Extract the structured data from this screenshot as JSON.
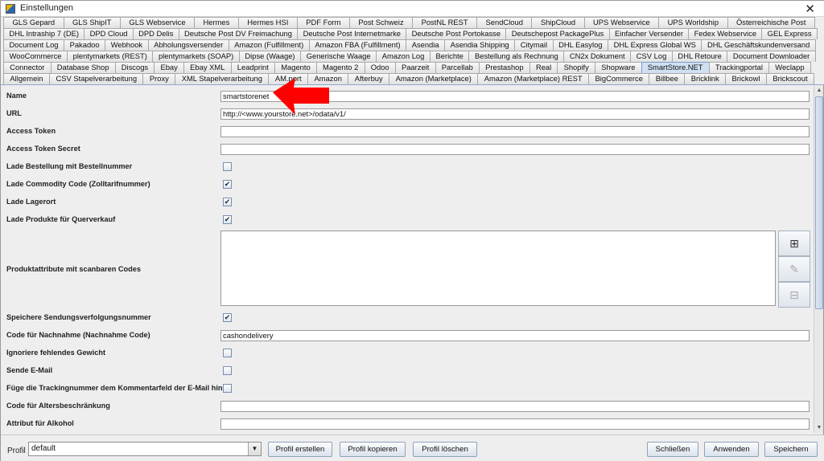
{
  "window": {
    "title": "Einstellungen",
    "close": "✕"
  },
  "tabs": {
    "rows": [
      [
        "GLS Gepard",
        "GLS ShipIT",
        "GLS Webservice",
        "Hermes",
        "Hermes HSI",
        "PDF Form",
        "Post Schweiz",
        "PostNL REST",
        "SendCloud",
        "ShipCloud",
        "UPS Webservice",
        "UPS Worldship",
        "Österreichische Post"
      ],
      [
        "DHL Intraship 7 (DE)",
        "DPD Cloud",
        "DPD Delis",
        "Deutsche Post DV Freimachung",
        "Deutsche Post Internetmarke",
        "Deutsche Post Portokasse",
        "Deutschepost PackagePlus",
        "Einfacher Versender",
        "Fedex Webservice",
        "GEL Express"
      ],
      [
        "Document Log",
        "Pakadoo",
        "Webhook",
        "Abholungsversender",
        "Amazon (Fulfillment)",
        "Amazon FBA (Fulfillment)",
        "Asendia",
        "Asendia Shipping",
        "Citymail",
        "DHL Easylog",
        "DHL Express Global WS",
        "DHL Geschäftskundenversand"
      ],
      [
        "WooCommerce",
        "plentymarkets (REST)",
        "plentymarkets (SOAP)",
        "Dipse (Waage)",
        "Generische Waage",
        "Amazon Log",
        "Berichte",
        "Bestellung als Rechnung",
        "CN2x Dokument",
        "CSV Log",
        "DHL Retoure",
        "Document Downloader"
      ],
      [
        "Connector",
        "Database Shop",
        "Discogs",
        "Ebay",
        "Ebay XML",
        "Leadprint",
        "Magento",
        "Magento 2",
        "Odoo",
        "Paarzeit",
        "Parcellab",
        "Prestashop",
        "Real",
        "Shopify",
        "Shopware",
        "SmartStore.NET",
        "Trackingportal",
        "Weclapp"
      ],
      [
        "Allgemein",
        "CSV Stapelverarbeitung",
        "Proxy",
        "XML Stapelverarbeitung",
        "AM.port",
        "Amazon",
        "Afterbuy",
        "Amazon (Marketplace)",
        "Amazon (Marketplace) REST",
        "BigCommerce",
        "Billbee",
        "Bricklink",
        "Brickowl",
        "Brickscout"
      ]
    ],
    "active": "SmartStore.NET"
  },
  "form": {
    "name": {
      "label": "Name",
      "value": "smartstorenet"
    },
    "url": {
      "label": "URL",
      "value": "http://<www.yourstore.net>/odata/v1/"
    },
    "access_token": {
      "label": "Access Token",
      "value": ""
    },
    "access_token_secret": {
      "label": "Access Token Secret",
      "value": ""
    },
    "lade_bestellung": {
      "label": "Lade Bestellung mit Bestellnummer",
      "checked": false
    },
    "lade_commodity": {
      "label": "Lade Commodity Code (Zolltarifnummer)",
      "checked": true
    },
    "lade_lagerort": {
      "label": "Lade Lagerort",
      "checked": true
    },
    "lade_produkte": {
      "label": "Lade Produkte für Querverkauf",
      "checked": true
    },
    "produktattribute": {
      "label": "Produktattribute mit scanbaren Codes"
    },
    "speichere_sendung": {
      "label": "Speichere Sendungsverfolgungsnummer",
      "checked": true
    },
    "code_nachnahme": {
      "label": "Code für Nachnahme (Nachnahme Code)",
      "value": "cashondelivery"
    },
    "ignoriere_gewicht": {
      "label": "Ignoriere fehlendes Gewicht",
      "checked": false
    },
    "sende_email": {
      "label": "Sende E-Mail",
      "checked": false
    },
    "fuege_tracking": {
      "label": "Füge die Trackingnummer dem Kommentarfeld der E-Mail hinzu",
      "checked": false
    },
    "code_alters": {
      "label": "Code für Altersbeschränkung",
      "value": ""
    },
    "attribut_alkohol": {
      "label": "Attribut für Alkohol",
      "value": ""
    }
  },
  "bottom": {
    "profil_label": "Profil",
    "profil_value": "default",
    "profil_erstellen": "Profil erstellen",
    "profil_kopieren": "Profil kopieren",
    "profil_loeschen": "Profil löschen",
    "schliessen": "Schließen",
    "anwenden": "Anwenden",
    "speichern": "Speichern"
  },
  "icons": {
    "check": "✔",
    "add": "⊞",
    "edit": "✎",
    "remove": "⊟",
    "scroll_up": "▲",
    "scroll_down": "▼",
    "dropdown": "▼"
  },
  "colors": {
    "active_tab": "#cfe0f3",
    "annotation_arrow": "#ff0000"
  }
}
